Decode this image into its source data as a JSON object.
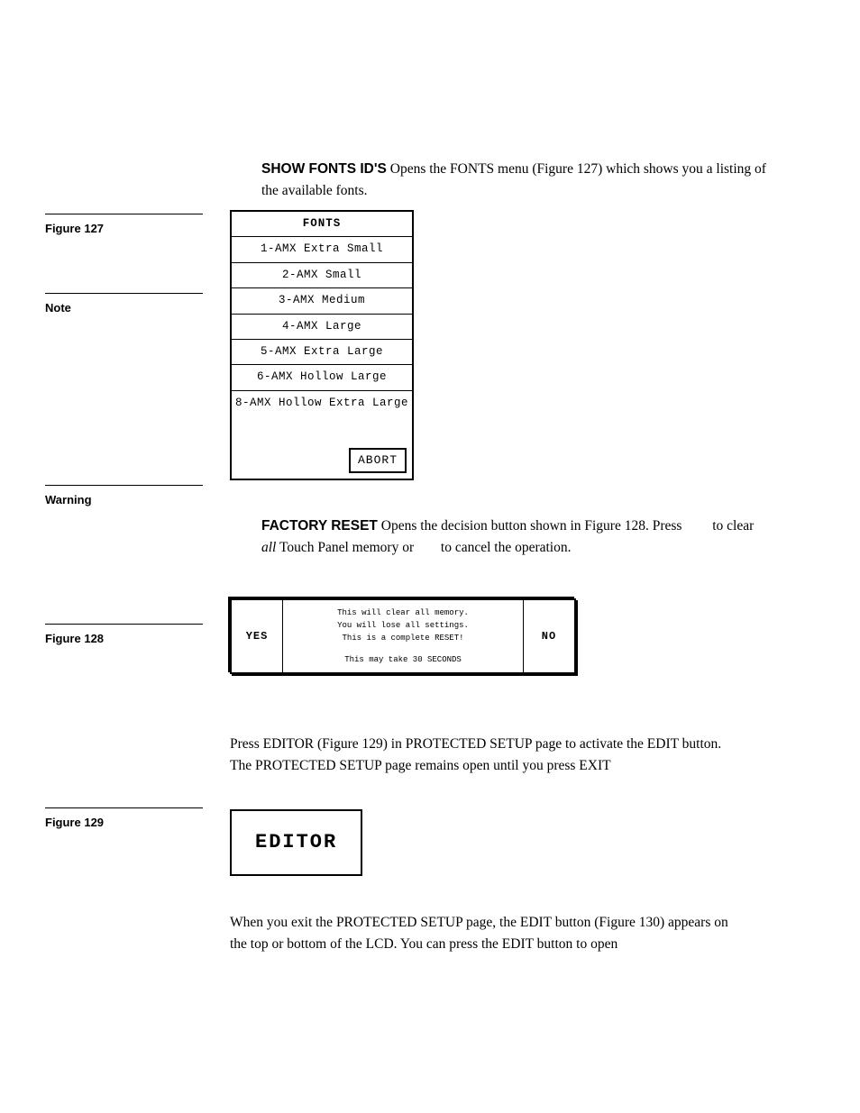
{
  "left": {
    "fig127": "Figure 127",
    "note": "Note",
    "warning": "Warning",
    "fig128": "Figure 128",
    "fig129": "Figure 129"
  },
  "p1": {
    "lead": "SHOW FONTS ID'S",
    "rest1": "Opens the FONTS menu (Figure 127) which shows",
    "rest2": "you a listing of the available fonts."
  },
  "fontsMenu": {
    "title": "FONTS",
    "rows": [
      "1-AMX Extra Small",
      "2-AMX Small",
      "3-AMX Medium",
      "4-AMX Large",
      "5-AMX Extra Large",
      "6-AMX Hollow Large",
      "8-AMX Hollow Extra Large"
    ],
    "abort": "ABORT"
  },
  "p2": {
    "lead": "FACTORY RESET",
    "seg1": "Opens the decision button shown in Figure 128. Press",
    "seg2": "to clear",
    "seg_ital": "all",
    "seg3": "Touch Panel memory or",
    "seg4": "to cancel the operation."
  },
  "confirm": {
    "yes": "YES",
    "no": "NO",
    "line1": "This will clear all memory.",
    "line2": "You will lose all settings.",
    "line3": "This is a complete RESET!",
    "line4": "This may take 30 SECONDS"
  },
  "p3": "Press EDITOR (Figure 129) in PROTECTED SETUP page to activate the EDIT button. The PROTECTED SETUP page remains open until you press EXIT",
  "editor": "EDITOR",
  "p4": "When you exit the PROTECTED SETUP page, the EDIT button (Figure 130) appears on the top or bottom of the LCD. You can press the EDIT button to open"
}
